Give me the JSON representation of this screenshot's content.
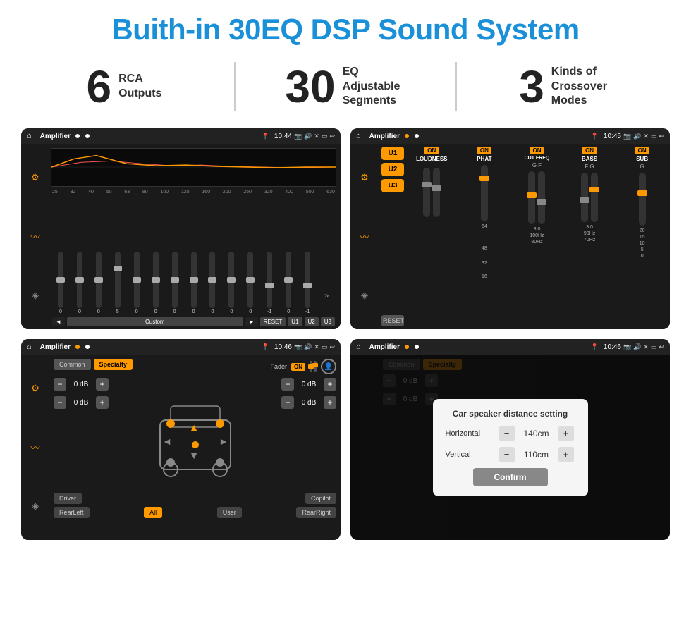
{
  "title": "Buith-in 30EQ DSP Sound System",
  "stats": [
    {
      "number": "6",
      "label": "RCA\nOutputs"
    },
    {
      "number": "30",
      "label": "EQ Adjustable\nSegments"
    },
    {
      "number": "3",
      "label": "Kinds of\nCrossover Modes"
    }
  ],
  "screenshots": [
    {
      "id": "eq-screen",
      "statusBar": {
        "title": "Amplifier",
        "time": "10:44",
        "dots": [
          false,
          false
        ]
      },
      "eqFrequencies": [
        "25",
        "32",
        "40",
        "50",
        "63",
        "80",
        "100",
        "125",
        "160",
        "200",
        "250",
        "320",
        "400",
        "500",
        "630"
      ],
      "eqValues": [
        "0",
        "0",
        "0",
        "5",
        "0",
        "0",
        "0",
        "0",
        "0",
        "0",
        "0",
        "-1",
        "0",
        "-1"
      ],
      "bottomBtns": [
        "◄",
        "Custom",
        "►",
        "RESET",
        "U1",
        "U2",
        "U3"
      ]
    },
    {
      "id": "amp-screen",
      "statusBar": {
        "title": "Amplifier",
        "time": "10:45",
        "dots": [
          true,
          false
        ]
      },
      "presets": [
        "U1",
        "U2",
        "U3"
      ],
      "controls": [
        {
          "label": "LOUDNESS",
          "on": true,
          "val": ""
        },
        {
          "label": "PHAT",
          "on": true,
          "val": ""
        },
        {
          "label": "CUT FREQ",
          "on": true,
          "val": "F"
        },
        {
          "label": "BASS",
          "on": true,
          "val": "G"
        },
        {
          "label": "SUB",
          "on": true,
          "val": "G"
        }
      ],
      "resetBtn": "RESET"
    },
    {
      "id": "cs-screen",
      "statusBar": {
        "title": "Amplifier",
        "time": "10:46",
        "dots": [
          true,
          false
        ]
      },
      "tabs": [
        "Common",
        "Specialty"
      ],
      "activeTab": 1,
      "faderLabel": "Fader",
      "faderOn": "ON",
      "dbValues": [
        "0 dB",
        "0 dB",
        "0 dB",
        "0 dB"
      ],
      "bottomBtns": [
        "Driver",
        "",
        "Copilot",
        "RearLeft",
        "All",
        "User",
        "RearRight"
      ]
    },
    {
      "id": "csd-screen",
      "statusBar": {
        "title": "Amplifier",
        "time": "10:46",
        "dots": [
          true,
          false
        ]
      },
      "tabs": [
        "Common",
        "Specialty"
      ],
      "activeTab": 0,
      "dialog": {
        "title": "Car speaker distance setting",
        "horizontal": {
          "label": "Horizontal",
          "value": "140cm"
        },
        "vertical": {
          "label": "Vertical",
          "value": "110cm"
        },
        "confirmBtn": "Confirm"
      }
    }
  ]
}
